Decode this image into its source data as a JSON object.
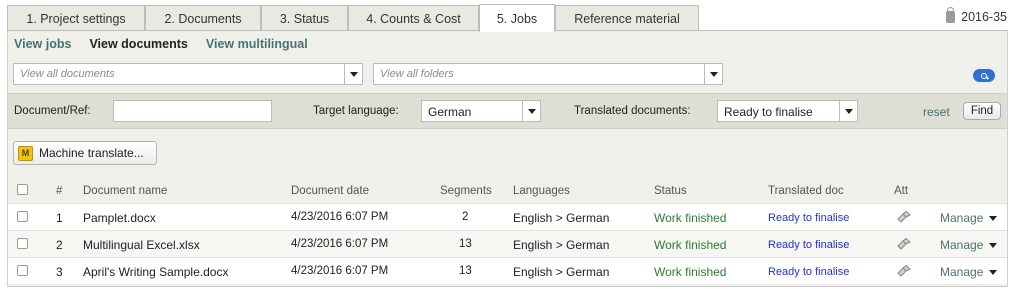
{
  "tabs": [
    {
      "label": "1. Project settings"
    },
    {
      "label": "2. Documents"
    },
    {
      "label": "3. Status"
    },
    {
      "label": "4. Counts & Cost"
    },
    {
      "label": "5. Jobs",
      "active": true
    },
    {
      "label": "Reference material"
    }
  ],
  "job_id": "2016-35",
  "subnav": {
    "view_jobs": "View jobs",
    "view_documents": "View documents",
    "view_multilingual": "View multilingual"
  },
  "search": {
    "documents_placeholder": "View all documents",
    "folders_placeholder": "View all folders"
  },
  "filters": {
    "document_ref_label": "Document/Ref:",
    "document_ref_value": "",
    "target_language_label": "Target language:",
    "target_language_value": "German",
    "translated_docs_label": "Translated documents:",
    "translated_docs_value": "Ready to finalise",
    "reset": "reset",
    "find": "Find"
  },
  "machine_translate": "Machine translate...",
  "table": {
    "headers": {
      "num": "#",
      "name": "Document name",
      "date": "Document date",
      "segments": "Segments",
      "languages": "Languages",
      "status": "Status",
      "translated": "Translated doc",
      "att": "Att"
    },
    "rows": [
      {
        "num": "1",
        "name": "Pamplet.docx",
        "date": "4/23/2016 6:07 PM",
        "segments": "2",
        "languages": "English > German",
        "status": "Work finished",
        "translated": "Ready to finalise",
        "manage": "Manage"
      },
      {
        "num": "2",
        "name": "Multilingual Excel.xlsx",
        "date": "4/23/2016 6:07 PM",
        "segments": "13",
        "languages": "English > German",
        "status": "Work finished",
        "translated": "Ready to finalise",
        "manage": "Manage"
      },
      {
        "num": "3",
        "name": "April's Writing Sample.docx",
        "date": "4/23/2016 6:07 PM",
        "segments": "13",
        "languages": "English > German",
        "status": "Work finished",
        "translated": "Ready to finalise",
        "manage": "Manage"
      }
    ]
  },
  "colors": {
    "accent_link": "#4a7270",
    "status_green": "#2e7d32",
    "link_blue": "#2233cc",
    "search_blue": "#2f6fd6"
  }
}
